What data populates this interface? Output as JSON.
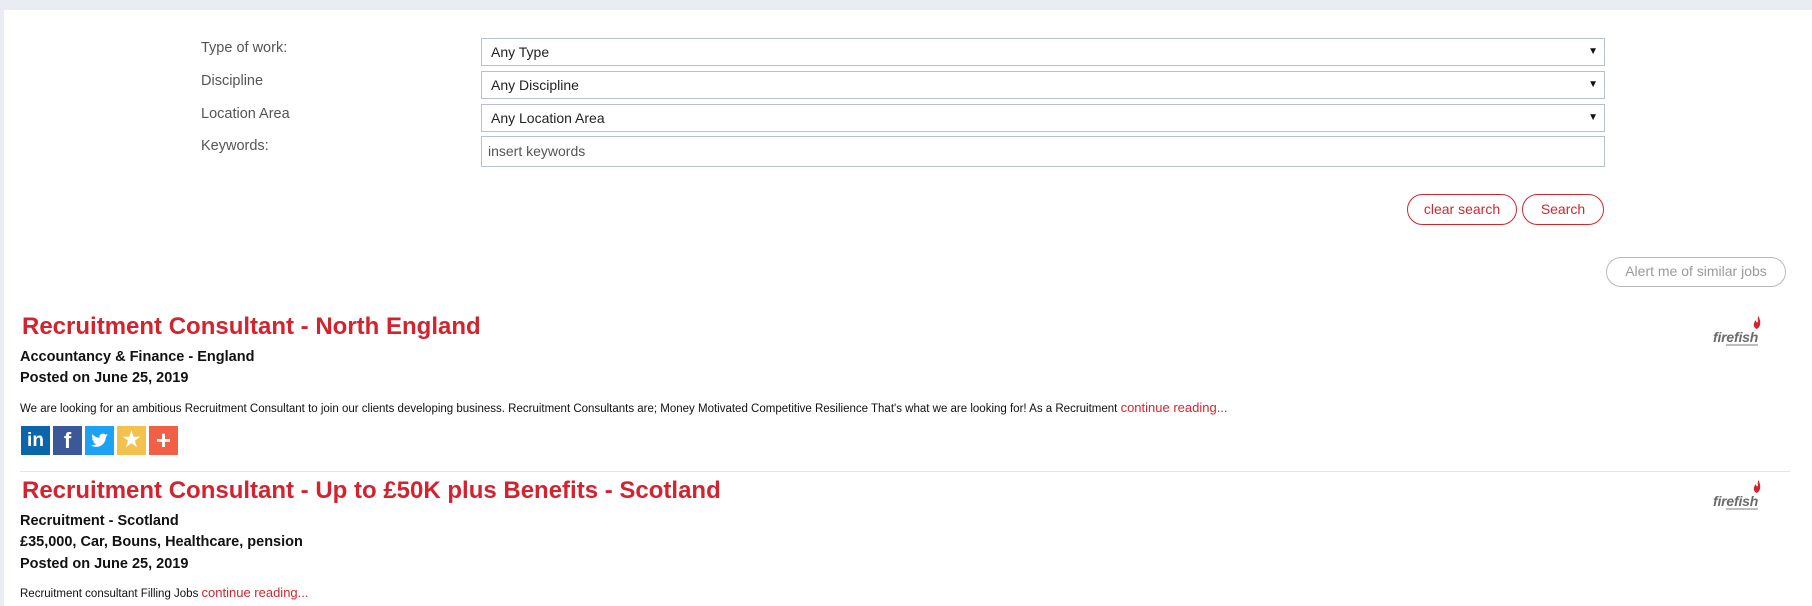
{
  "filters": {
    "type_label": "Type of work:",
    "type_value": "Any Type",
    "discipline_label": "Discipline",
    "discipline_value": "Any Discipline",
    "location_label": "Location Area",
    "location_value": "Any Location Area",
    "keywords_label": "Keywords:",
    "keywords_placeholder": "insert keywords",
    "dropdown_arrow": "▼"
  },
  "buttons": {
    "clear": "clear search",
    "search": "Search",
    "alert": "Alert me of similar jobs"
  },
  "jobs": [
    {
      "title": "Recruitment Consultant - North England",
      "category": "Accountancy & Finance - England",
      "posted": "Posted on June 25, 2019",
      "description": "We are looking for an ambitious Recruitment Consultant to join our clients developing business. Recruitment Consultants are; Money Motivated Competitive Resilience That's what we are looking for! As a Recruitment ",
      "more": "continue reading...",
      "logo": "firefish"
    },
    {
      "title": "Recruitment Consultant - Up to £50K plus Benefits - Scotland",
      "category": "Recruitment - Scotland",
      "salary": "£35,000, Car, Bouns, Healthcare, pension",
      "posted": "Posted on June 25, 2019",
      "description": "Recruitment consultant  Filling Jobs ",
      "more": "continue reading...",
      "logo": "firefish"
    }
  ],
  "share": {
    "linkedin": "in",
    "facebook": "f",
    "twitter": "twitter-bird",
    "favorite": "★",
    "more": "+"
  },
  "colors": {
    "accent": "#d2232e",
    "linkedin": "#0a66a8",
    "facebook": "#3b5998",
    "twitter": "#1da1f2",
    "favorite": "#f2c14e",
    "more": "#f25f47"
  }
}
